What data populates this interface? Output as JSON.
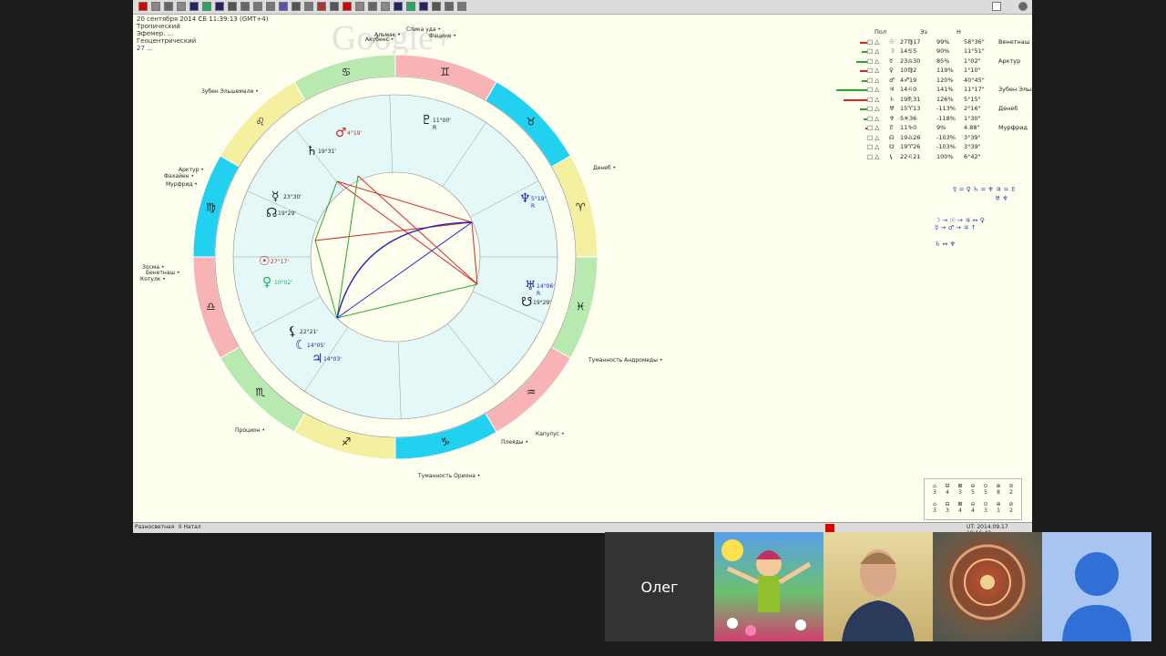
{
  "header": {
    "date_line": "20 сентября 2014  СБ  11:39:13 (GMT+4)",
    "sub1": "Тропический",
    "sub2": "Эфемер. ...",
    "sub3": "Геоцентрический",
    "sub4": "27 ...",
    "overlay_brand": "Google+"
  },
  "fixed_stars": [
    {
      "label": "Спика уда",
      "id": "star-spica"
    },
    {
      "label": "Акубенс",
      "id": "star-acubens"
    },
    {
      "label": "Альмак",
      "id": "star-almak"
    },
    {
      "label": "Фацине",
      "id": "star-facies"
    },
    {
      "label": "Зубен Эльшемали",
      "id": "star-zuben"
    },
    {
      "label": "Арктур",
      "id": "star-arcturus"
    },
    {
      "label": "Фахайен",
      "id": "star-fahayen"
    },
    {
      "label": "Мурфрид",
      "id": "star-murfrid"
    },
    {
      "label": "Денеб",
      "id": "star-deneb"
    },
    {
      "label": "Зосма",
      "id": "star-zosma"
    },
    {
      "label": "Бенетнаш",
      "id": "star-benetnash"
    },
    {
      "label": "Котулк",
      "id": "star-kotulk"
    },
    {
      "label": "Туманность Андромеды",
      "id": "star-andromeda"
    },
    {
      "label": "Капулус",
      "id": "star-capulus"
    },
    {
      "label": "Плеяды",
      "id": "star-pleiades"
    },
    {
      "label": "Туманность Ориона",
      "id": "star-orion"
    },
    {
      "label": "Процион",
      "id": "star-procyon"
    }
  ],
  "planets_in_chart": [
    {
      "glyph": "♇",
      "deg": "11°00'",
      "note": "R"
    },
    {
      "glyph": "♂",
      "deg": "4°19'"
    },
    {
      "glyph": "♄",
      "deg": "19°31'"
    },
    {
      "glyph": "☿",
      "deg": "23°30'"
    },
    {
      "glyph": "☊",
      "deg": "19°29'"
    },
    {
      "glyph": "☉",
      "deg": "27°17'"
    },
    {
      "glyph": "♀",
      "deg": "10°02'"
    },
    {
      "glyph": "♆",
      "deg": "5°19'",
      "note": "R"
    },
    {
      "glyph": "♅",
      "deg": "14°06'",
      "note": "R"
    },
    {
      "glyph": "☋",
      "deg": "19°29'"
    },
    {
      "glyph": "☾",
      "deg": "14°05'"
    },
    {
      "glyph": "♃",
      "deg": "14°03'"
    },
    {
      "glyph": "⚸",
      "deg": "22°21'"
    }
  ],
  "table": {
    "col_headers": [
      "Пол",
      "Эз",
      "Н"
    ],
    "rows": [
      {
        "g": "☉",
        "pos": "27♍17",
        "pct": "99%",
        "dec": "58°36\"",
        "star": "Венетнаш"
      },
      {
        "g": "☽",
        "pos": "14♋5",
        "pct": "90%",
        "dec": "11°51\"",
        "star": ""
      },
      {
        "g": "☿",
        "pos": "23♎30",
        "pct": "85%",
        "dec": "1°02\"",
        "star": "Арктур"
      },
      {
        "g": "♀",
        "pos": "10♍2",
        "pct": "119%",
        "dec": "1°10\"",
        "star": ""
      },
      {
        "g": "♂",
        "pos": "4♐19",
        "pct": "120%",
        "dec": "40°45\"",
        "star": ""
      },
      {
        "g": "♃",
        "pos": "14♌0",
        "pct": "141%",
        "dec": "11°17\"",
        "star": "Зубен Эльшемали"
      },
      {
        "g": "♄",
        "pos": "19♏31",
        "pct": "126%",
        "dec": "5°15\"",
        "star": ""
      },
      {
        "g": "♅",
        "pos": "15♈13",
        "pct": "-113%",
        "dec": "2°16\"",
        "star": "Денеб"
      },
      {
        "g": "♆",
        "pos": "5♓36",
        "pct": "-118%",
        "dec": "1°30\"",
        "star": ""
      },
      {
        "g": "♇",
        "pos": "11♑0",
        "pct": "9%",
        "dec": "4.88\"",
        "star": "Мурфрид"
      },
      {
        "g": "☊",
        "pos": "19♎26",
        "pct": "-103%",
        "dec": "3°39\"",
        "star": ""
      },
      {
        "g": "☋",
        "pos": "19♈26",
        "pct": "-103%",
        "dec": "3°39\"",
        "star": ""
      },
      {
        "g": "⚸",
        "pos": "22♌21",
        "pct": "100%",
        "dec": "6°42\"",
        "star": ""
      }
    ]
  },
  "configs": [
    "☿ = ♀ ♄ = ♆ ♃ = ♇",
    "♅ ♆",
    "☽ → ☉ → ♃ ↔ ♀",
    "☿ → ♂ → ♃ ↑",
    "♄ ↔ ♆"
  ],
  "elements": {
    "top": [
      "3",
      "4",
      "3",
      "5",
      "5",
      "8",
      "2"
    ],
    "bottom": [
      "3",
      "3",
      "4",
      "4",
      "3",
      "1",
      "2"
    ]
  },
  "status": {
    "left": "Разносветная",
    "mid": "II Натал",
    "right": "UT: 2014.09.17 19:16:42"
  },
  "hangout": {
    "name": "Олег"
  },
  "colors": {
    "fire": "#f8b4b4",
    "earth": "#b8eab0",
    "air": "#f4f0a0",
    "water": "#22d0f0",
    "inner": "#e4f8f8"
  }
}
